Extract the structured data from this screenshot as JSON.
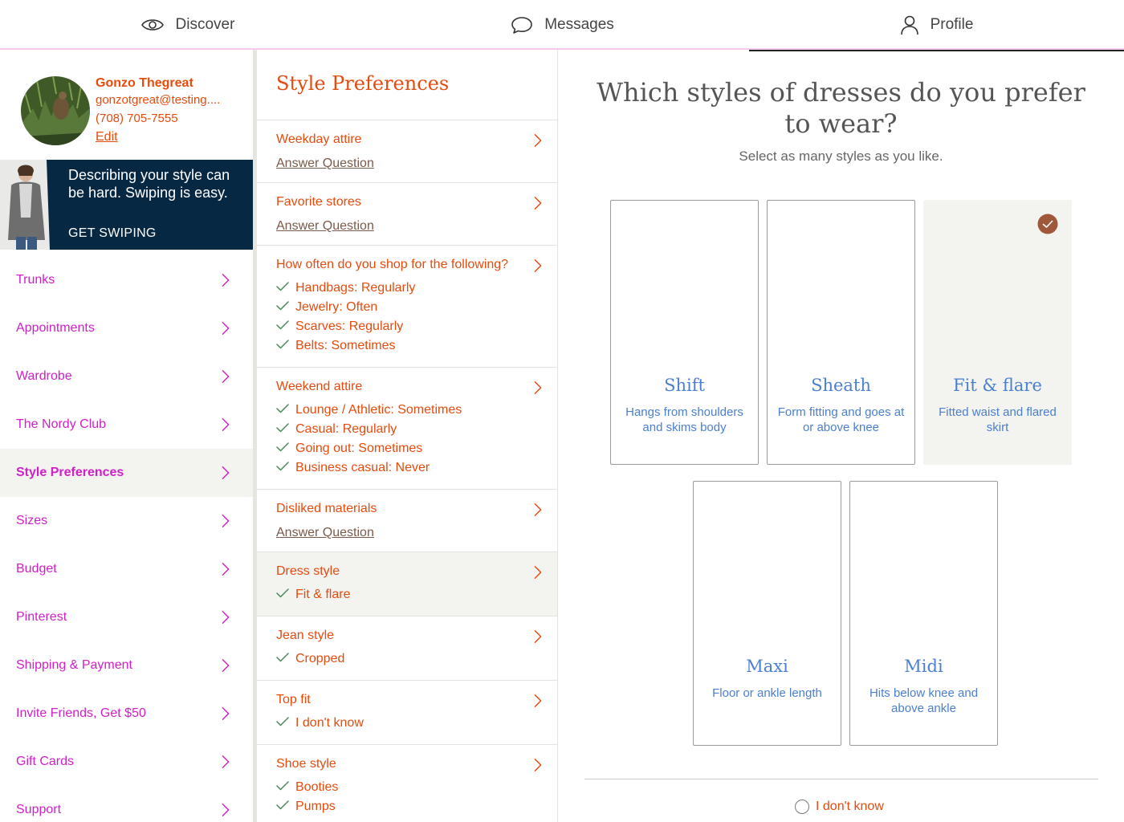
{
  "topnav": {
    "tabs": [
      {
        "label": "Discover",
        "icon": "eye-icon"
      },
      {
        "label": "Messages",
        "icon": "chat-bubble-icon"
      },
      {
        "label": "Profile",
        "icon": "person-icon",
        "active": true
      }
    ]
  },
  "profile": {
    "name": "Gonzo Thegreat",
    "email": "gonzotgreat@testing....",
    "phone": "(708) 705-7555",
    "edit_label": "Edit"
  },
  "banner": {
    "text": "Describing your style can be hard. Swiping is easy.",
    "cta": "GET SWIPING"
  },
  "menu": {
    "items": [
      {
        "label": "Trunks"
      },
      {
        "label": "Appointments"
      },
      {
        "label": "Wardrobe"
      },
      {
        "label": "The Nordy Club"
      },
      {
        "label": "Style Preferences",
        "selected": true
      },
      {
        "label": "Sizes"
      },
      {
        "label": "Budget"
      },
      {
        "label": "Pinterest"
      },
      {
        "label": "Shipping & Payment"
      },
      {
        "label": "Invite Friends, Get $50"
      },
      {
        "label": "Gift Cards"
      },
      {
        "label": "Support"
      }
    ]
  },
  "style_prefs": {
    "title": "Style Preferences",
    "answer_link": "Answer Question",
    "questions": [
      {
        "title": "Weekday attire",
        "answers": []
      },
      {
        "title": "Favorite stores",
        "answers": []
      },
      {
        "title": "How often do you shop for the following?",
        "answers": [
          "Handbags: Regularly",
          "Jewelry: Often",
          "Scarves: Regularly",
          "Belts: Sometimes"
        ]
      },
      {
        "title": "Weekend attire",
        "answers": [
          "Lounge / Athletic: Sometimes",
          "Casual: Regularly",
          "Going out: Sometimes",
          "Business casual: Never"
        ]
      },
      {
        "title": "Disliked materials",
        "answers": []
      },
      {
        "title": "Dress style",
        "answers": [
          "Fit & flare"
        ],
        "selected": true
      },
      {
        "title": "Jean style",
        "answers": [
          "Cropped"
        ]
      },
      {
        "title": "Top fit",
        "answers": [
          "I don't know"
        ]
      },
      {
        "title": "Shoe style",
        "answers": [
          "Booties",
          "Pumps"
        ]
      }
    ]
  },
  "dress_question": {
    "heading": "Which styles of dresses do you prefer to wear?",
    "subtext": "Select as many styles as you like.",
    "options": [
      {
        "title": "Shift",
        "desc": "Hangs from shoulders and skims body",
        "selected": false
      },
      {
        "title": "Sheath",
        "desc": "Form fitting and goes at or above knee",
        "selected": false
      },
      {
        "title": "Fit & flare",
        "desc": "Fitted waist and flared skirt",
        "selected": true
      },
      {
        "title": "Maxi",
        "desc": "Floor or ankle length",
        "selected": false
      },
      {
        "title": "Midi",
        "desc": "Hits below knee and above ankle",
        "selected": false
      }
    ],
    "dont_know_label": "I don't know"
  },
  "colors": {
    "accent_orange": "#e64b0e",
    "menu_magenta": "#d020c8",
    "card_blue": "#4a7fd1",
    "banner_navy": "#062842",
    "check_brown": "#a0583a",
    "selected_bg": "#f3f3ef"
  }
}
